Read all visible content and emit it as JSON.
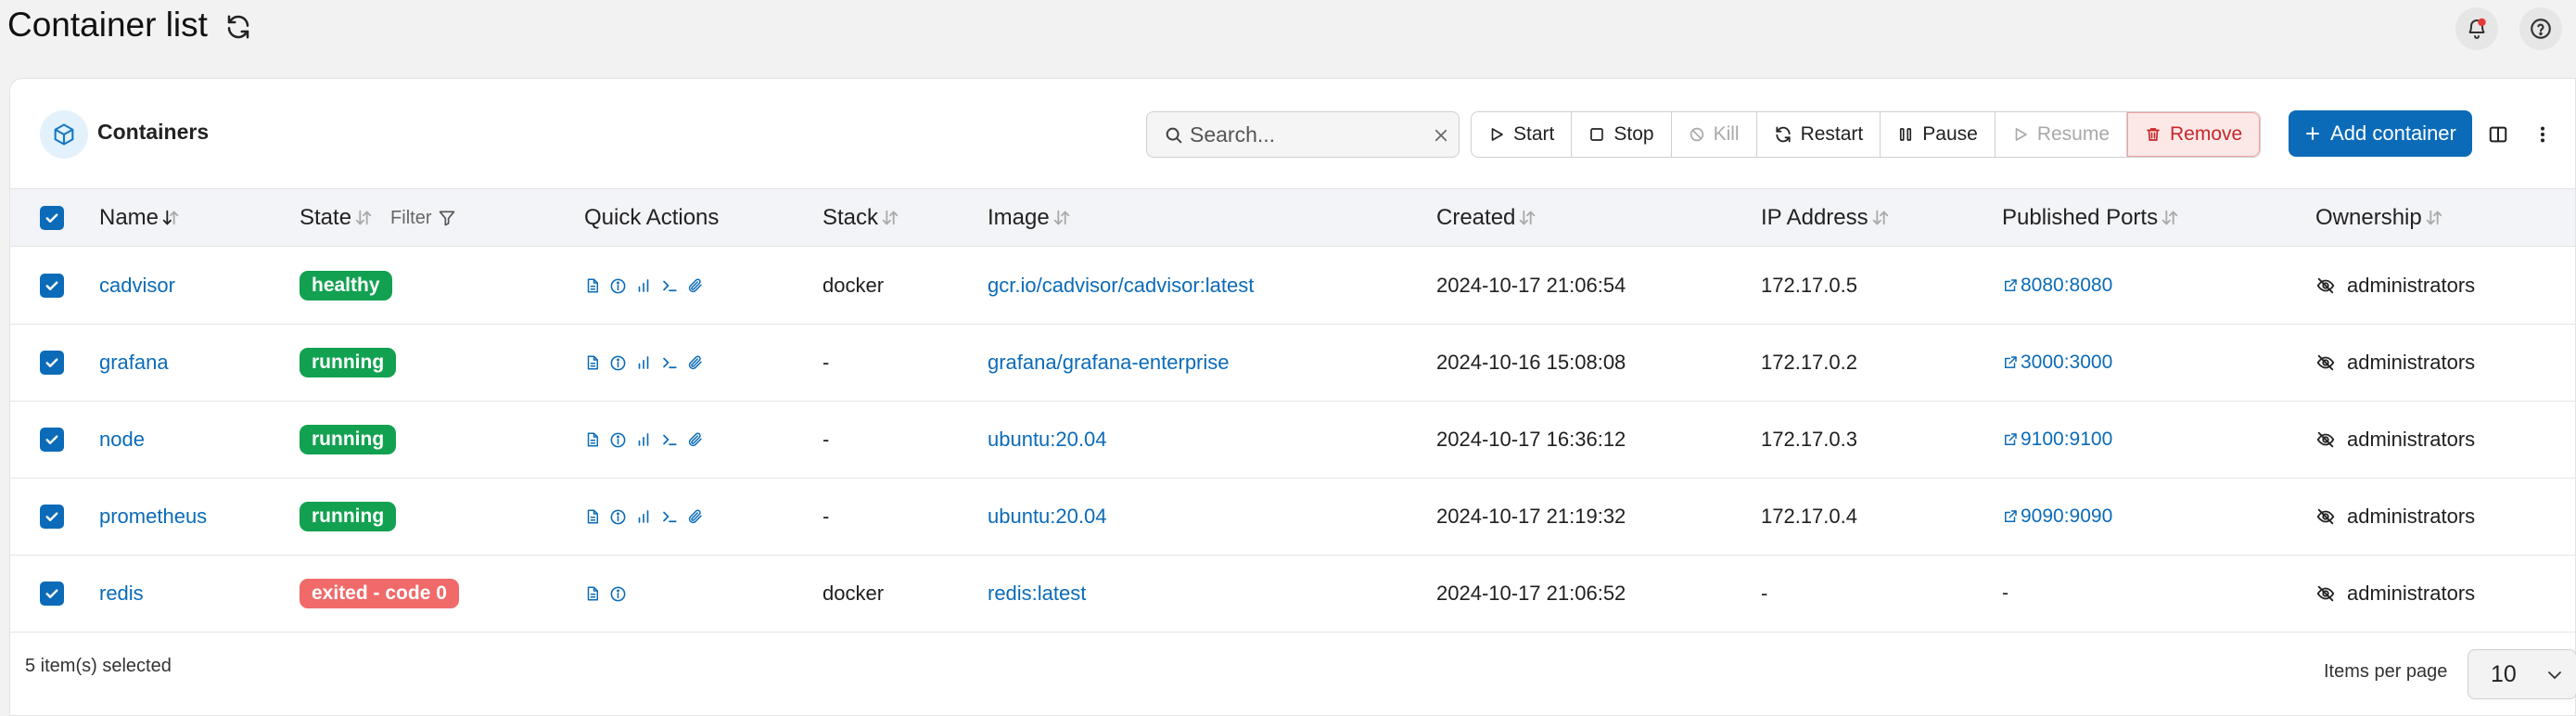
{
  "header": {
    "title": "Container list",
    "icons": [
      "refresh-icon",
      "bell-icon",
      "help-icon"
    ],
    "notification_dot_color": "#e53935"
  },
  "card": {
    "title": "Containers",
    "title_icon": "cube-icon"
  },
  "search": {
    "placeholder": "Search...",
    "value": ""
  },
  "actions": [
    {
      "label": "Start",
      "icon": "play-icon",
      "enabled": true
    },
    {
      "label": "Stop",
      "icon": "stop-icon",
      "enabled": true
    },
    {
      "label": "Kill",
      "icon": "ban-icon",
      "enabled": false
    },
    {
      "label": "Restart",
      "icon": "restart-icon",
      "enabled": true
    },
    {
      "label": "Pause",
      "icon": "pause-icon",
      "enabled": true
    },
    {
      "label": "Resume",
      "icon": "play-icon",
      "enabled": false
    },
    {
      "label": "Remove",
      "icon": "trash-icon",
      "enabled": true
    }
  ],
  "add_button": "Add container",
  "columns": {
    "name": "Name",
    "state": "State",
    "state_filter": "Filter",
    "quick_actions": "Quick Actions",
    "stack": "Stack",
    "image": "Image",
    "created": "Created",
    "ip": "IP Address",
    "ports": "Published Ports",
    "ownership": "Ownership"
  },
  "rows": [
    {
      "name": "cadvisor",
      "state": "healthy",
      "state_kind": "ok",
      "full_actions": true,
      "stack": "docker",
      "image": "gcr.io/cadvisor/cadvisor:latest",
      "created": "2024-10-17 21:06:54",
      "ip": "172.17.0.5",
      "port": "8080:8080",
      "ownership": "administrators"
    },
    {
      "name": "grafana",
      "state": "running",
      "state_kind": "ok",
      "full_actions": true,
      "stack": "-",
      "image": "grafana/grafana-enterprise",
      "created": "2024-10-16 15:08:08",
      "ip": "172.17.0.2",
      "port": "3000:3000",
      "ownership": "administrators"
    },
    {
      "name": "node",
      "state": "running",
      "state_kind": "ok",
      "full_actions": true,
      "stack": "-",
      "image": "ubuntu:20.04",
      "created": "2024-10-17 16:36:12",
      "ip": "172.17.0.3",
      "port": "9100:9100",
      "ownership": "administrators"
    },
    {
      "name": "prometheus",
      "state": "running",
      "state_kind": "ok",
      "full_actions": true,
      "stack": "-",
      "image": "ubuntu:20.04",
      "created": "2024-10-17 21:19:32",
      "ip": "172.17.0.4",
      "port": "9090:9090",
      "ownership": "administrators"
    },
    {
      "name": "redis",
      "state": "exited - code 0",
      "state_kind": "bad",
      "full_actions": false,
      "stack": "docker",
      "image": "redis:latest",
      "created": "2024-10-17 21:06:52",
      "ip": "-",
      "port": "-",
      "ownership": "administrators"
    }
  ],
  "footer": {
    "selected_text": "5 item(s) selected",
    "items_per_page_label": "Items per page",
    "items_per_page_value": "10"
  },
  "colors": {
    "accent": "#0b6bb8",
    "healthy": "#12a150",
    "exited": "#f06a6a",
    "remove": "#c62828"
  }
}
